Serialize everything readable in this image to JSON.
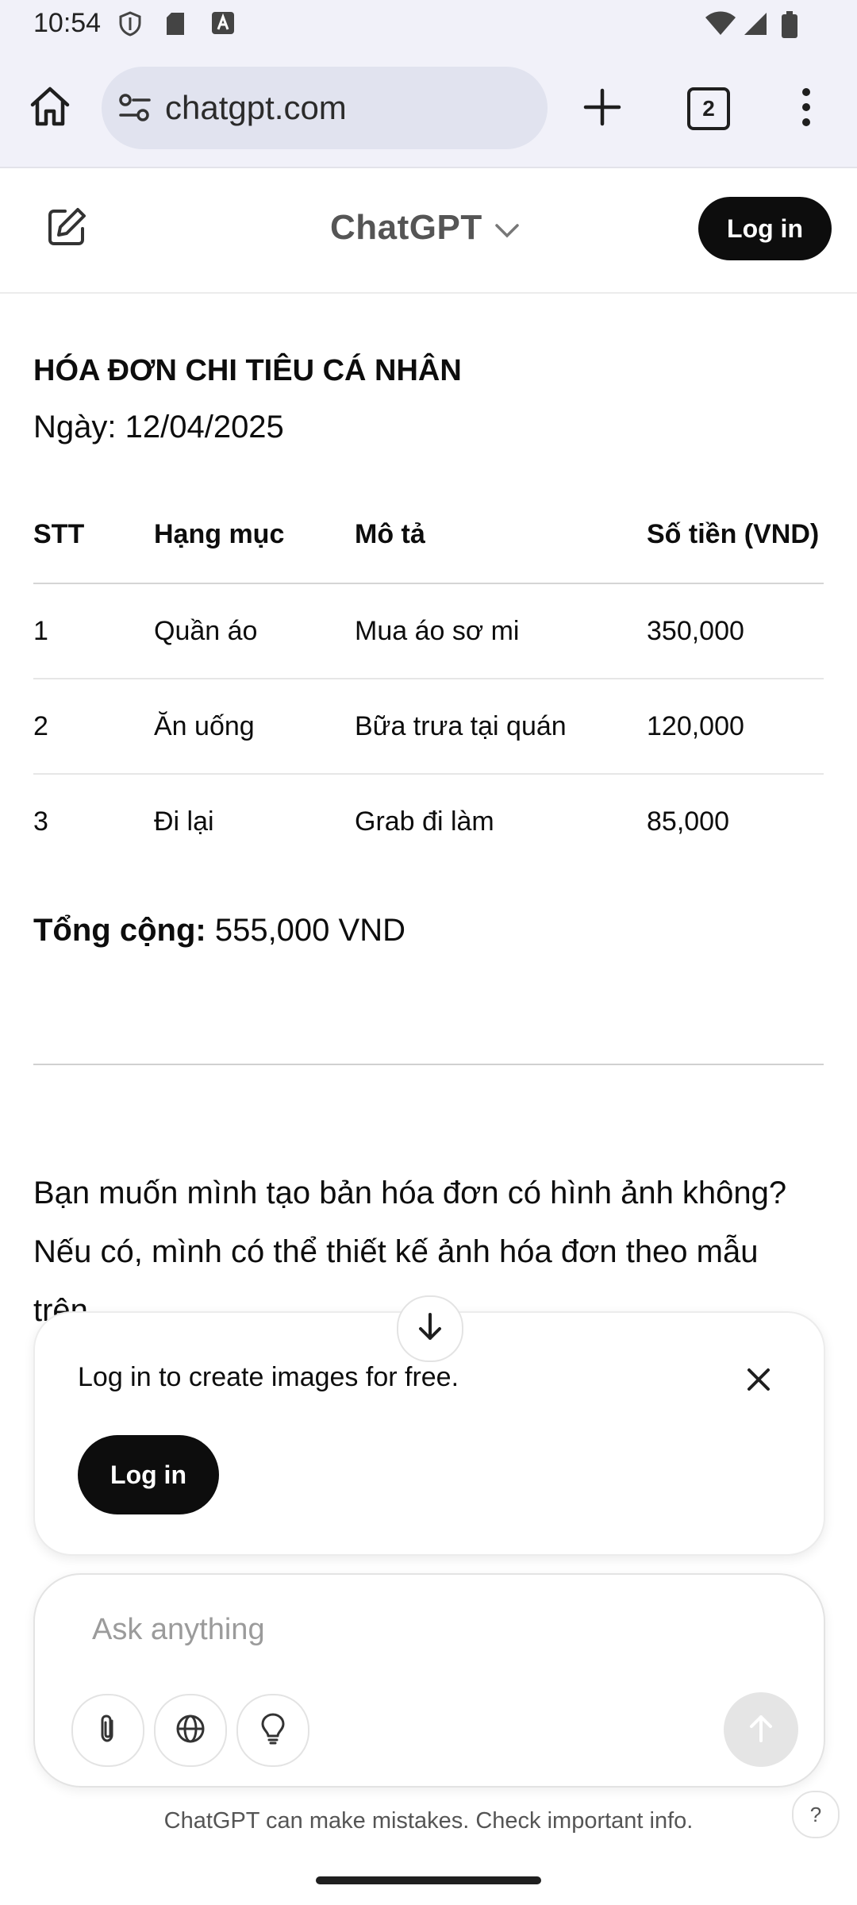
{
  "status_bar": {
    "time": "10:54"
  },
  "browser": {
    "url": "chatgpt.com",
    "tab_count": "2"
  },
  "app": {
    "title": "ChatGPT",
    "login_label": "Log in"
  },
  "invoice": {
    "title": "HÓA ĐƠN CHI TIÊU CÁ NHÂN",
    "date": "Ngày: 12/04/2025",
    "columns": [
      "STT",
      "Hạng mục",
      "Mô tả",
      "Số tiền (VND)"
    ],
    "rows": [
      [
        "1",
        "Quần áo",
        "Mua áo sơ mi",
        "350,000"
      ],
      [
        "2",
        "Ăn uống",
        "Bữa trưa tại quán",
        "120,000"
      ],
      [
        "3",
        "Đi lại",
        "Grab đi làm",
        "85,000"
      ]
    ],
    "total_label": "Tổng cộng:",
    "total_value": " 555,000 VND"
  },
  "message": {
    "text": "Bạn muốn mình tạo bản hóa đơn có hình ảnh không? Nếu có, mình có thể thiết kế ảnh hóa đơn theo mẫu trên."
  },
  "login_card": {
    "text": "Log in to create images for free.",
    "button_label": "Log in"
  },
  "composer": {
    "placeholder": "Ask anything"
  },
  "footer": {
    "note": "ChatGPT can make mistakes. Check important info.",
    "help": "?"
  }
}
